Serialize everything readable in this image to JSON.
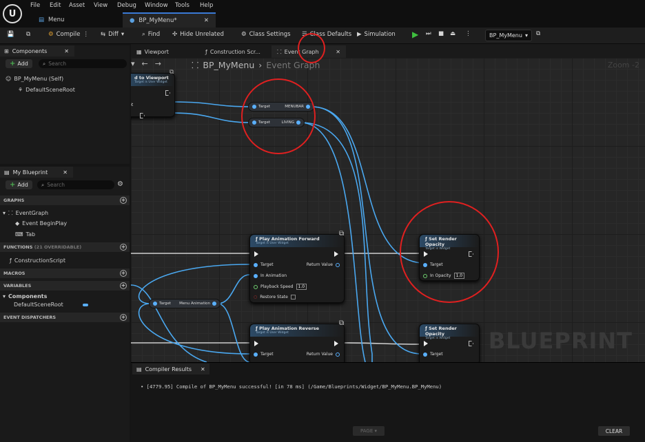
{
  "menubar": {
    "logo": "U",
    "items": [
      "File",
      "Edit",
      "Asset",
      "View",
      "Debug",
      "Window",
      "Tools",
      "Help"
    ],
    "doc_tabs": [
      {
        "label": "Menu"
      },
      {
        "label": "BP_MyMenu*"
      }
    ]
  },
  "toolbar": {
    "compile": "Compile",
    "diff": "Diff",
    "find": "Find",
    "hide_unrelated": "Hide Unrelated",
    "class_settings": "Class Settings",
    "class_defaults": "Class Defaults",
    "simulation": "Simulation",
    "debug_object": "BP_MyMenu"
  },
  "components_panel": {
    "title": "Components",
    "add": "Add",
    "search_placeholder": "Search",
    "items": [
      "BP_MyMenu (Self)",
      "DefaultSceneRoot"
    ]
  },
  "my_blueprint": {
    "title": "My Blueprint",
    "add": "Add",
    "search_placeholder": "Search",
    "graphs_header": "GRAPHS",
    "event_graph": "EventGraph",
    "event_begin_play": "Event BeginPlay",
    "tab_item": "Tab",
    "functions_header": "FUNCTIONS",
    "functions_count": "(21 OVERRIDABLE)",
    "construction_script": "ConstructionScript",
    "macros_header": "MACROS",
    "variables_header": "VARIABLES",
    "components_group": "Components",
    "default_scene_root": "DefaultSceneRoot",
    "event_dispatchers_header": "EVENT DISPATCHERS"
  },
  "graph_tabs": [
    "Viewport",
    "Construction Scr...",
    "Event Graph"
  ],
  "breadcrumb": {
    "root": "BP_MyMenu",
    "current": "Event Graph"
  },
  "zoom": "Zoom -2",
  "watermark": "BLUEPRINT",
  "nodes": {
    "add_to_viewport": {
      "title": "d to Viewport",
      "subtitle": "Target is User Widget",
      "pin": "rget"
    },
    "menubar_var": {
      "target": "Target",
      "name": "MENUBAR"
    },
    "living_var": {
      "target": "Target",
      "name": "LIVING"
    },
    "play_forward": {
      "title": "Play Animation Forward",
      "subtitle": "Target is User Widget",
      "target": "Target",
      "return": "Return Value",
      "in_anim": "In Animation",
      "speed_label": "Playback Speed",
      "speed": "1.0",
      "restore": "Restore State"
    },
    "menu_anim_var": {
      "target": "Target",
      "name": "Menu Animation"
    },
    "play_reverse": {
      "title": "Play Animation Reverse",
      "subtitle": "Target is User Widget",
      "target": "Target",
      "return": "Return Value"
    },
    "set_opacity_1": {
      "title": "Set Render Opacity",
      "subtitle": "Target is Widget",
      "target": "Target",
      "opacity_label": "In Opacity",
      "opacity": "1.0"
    },
    "set_opacity_2": {
      "title": "Set Render Opacity",
      "subtitle": "Target is Widget",
      "target": "Target"
    }
  },
  "compiler": {
    "tab": "Compiler Results",
    "message": "[4779.95] Compile of BP_MyMenu successful! [in 78 ms] (/Game/Blueprints/Widget/BP_MyMenu.BP_MyMenu)",
    "page": "PAGE",
    "clear": "CLEAR"
  },
  "colors": {
    "accent": "#3a7ad6",
    "annotation": "#e02020",
    "pin_blue": "#5ab0ff",
    "play_green": "#3fbf3f"
  }
}
